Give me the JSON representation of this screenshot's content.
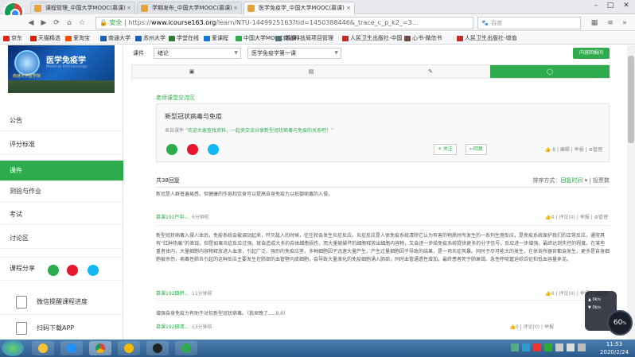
{
  "browser": {
    "tabs": [
      {
        "title": "课程管理_中国大学MOOC(慕课)"
      },
      {
        "title": "学期发布_中国大学MOOC(慕课)"
      },
      {
        "title": "医学免疫学_中国大学MOOC(慕课)"
      }
    ],
    "address": {
      "security_label": "安全",
      "scheme": "https://",
      "host": "www.icourse163.org",
      "path": "/learn/NTU-1449925163?tid=1450388446&_trace_c_p_k2_=3..."
    },
    "search_placeholder": "百度",
    "bookmarks": [
      {
        "label": "京东",
        "color": "#e1251b"
      },
      {
        "label": "天猫精选",
        "color": "#d81e06"
      },
      {
        "label": "爱淘宝",
        "color": "#ff5000"
      },
      {
        "label": "南通大学",
        "color": "#1a5fb4"
      },
      {
        "label": "苏州大学",
        "color": "#1a5fb4"
      },
      {
        "label": "学堂在线",
        "color": "#2e7d32"
      },
      {
        "label": "爱课程",
        "color": "#1976d2"
      },
      {
        "label": "中国大学MOOC(慕课)",
        "color": "#2eab4c"
      },
      {
        "label": "南通科技局项目管理",
        "color": "#546e7a"
      },
      {
        "label": "人民卫生出版社-中国",
        "color": "#c62828"
      },
      {
        "label": "心书-微信书",
        "color": "#6d4c41"
      },
      {
        "label": "人民卫生出版社-增值",
        "color": "#c62828"
      }
    ]
  },
  "sidebar": {
    "banner_title": "医学免疫学",
    "banner_subtitle": "Medical Immunology",
    "banner_school": "南通大学医学院",
    "items": [
      {
        "label": "公告"
      },
      {
        "label": "评分标准"
      },
      {
        "label": "课件"
      },
      {
        "label": "测验与作业"
      },
      {
        "label": "考试"
      },
      {
        "label": "讨论区"
      }
    ],
    "share_label": "课程分享",
    "wechat_reminder": "微信提醒课程进度",
    "download_app": "扫码下载APP"
  },
  "main": {
    "crumb_label": "课件",
    "select_chapter": "绪论",
    "select_lesson": "医学免疫学第一课",
    "forum_button": "内容回报问",
    "forum_link": "老师课堂交流区",
    "post": {
      "title": "新型冠状病毒与免疫",
      "from_label": "来自课件",
      "message": "欢迎大家查找资料，一起来交流分享新型冠状病毒与免疫的关系吧！",
      "follow_label": "+ 关注",
      "reply_label": "回复",
      "likes": "8",
      "edit_label": "编辑",
      "report_label": "举报",
      "manage_label": "管理"
    },
    "reply_count": "共38回复",
    "sort_label": "排序方式：",
    "sort_by_time": "回复时间",
    "sort_by_votes": "投票数",
    "replies": [
      {
        "text": "新冠是人群普遍易感，但健康的作息和饮食可以提高自身免疫力以抵御病毒的入侵。",
        "author": "慕课191严中...",
        "time": "6分钟前",
        "likes": "0",
        "comments": "评论(0)",
        "report": "举报",
        "manage": "管理"
      },
      {
        "text": "新型冠状病毒入侵人体后，免疫系统会被调动起来，歼灭敌人的时候，往往就会发生炎症反应。炎症反应是人体免疫系统清除它认为有害的物质时所发生的一系列生理反应，是免疫系统保护我们的正常反应，通常具有“红肿热痛”的表现。但是如果炎症反应过强，就会造成大多的自体细胞损伤，而大量被破坏的细胞释放出细胞内容物，又会进一步给免疫系统提供更多的分子信号，反应进一步增强，最终达到失控的程度。在某些重者体内，大量细胞内容物释放进入血液，引起广泛、强烈的免疫应答，多种细胞因子迅速大量产生，产生过量细胞因子导致的结果，是一场炎症风暴。同时于尽可能大的发生，在体各所器官都会发生，更多是自身细胞被杀伤，病毒性肺炎引起的这种反应主要发生在肺部的血管壁内皮细胞，会导致大量液化的免疫细胞涌入肺部，同时血管通透性增加，最终患者死于肺衰竭、急性呼吸窘迫综合征和低血容量休克。",
        "author": "慕课192田伊...",
        "time": "11分钟前",
        "likes": "0",
        "comments": "评论(0)",
        "report": "举报",
        "manage": "管理"
      },
      {
        "text": "增强自身免疫力有助于对抗新型冠状病毒。（我来晚了.....0.0）",
        "author": "慕课192田清...",
        "time": "13分钟前",
        "likes": "0",
        "comments": "评论(0)",
        "report": "举报",
        "manage": "管理"
      }
    ]
  },
  "overlay": {
    "speed_value": "60",
    "speed_unit": "%",
    "up_rate": "0k/s",
    "down_rate": "0k/s"
  },
  "taskbar": {
    "time": "11:53",
    "date": "2020/2/24"
  },
  "colors": {
    "accent": "#2eab4c"
  }
}
